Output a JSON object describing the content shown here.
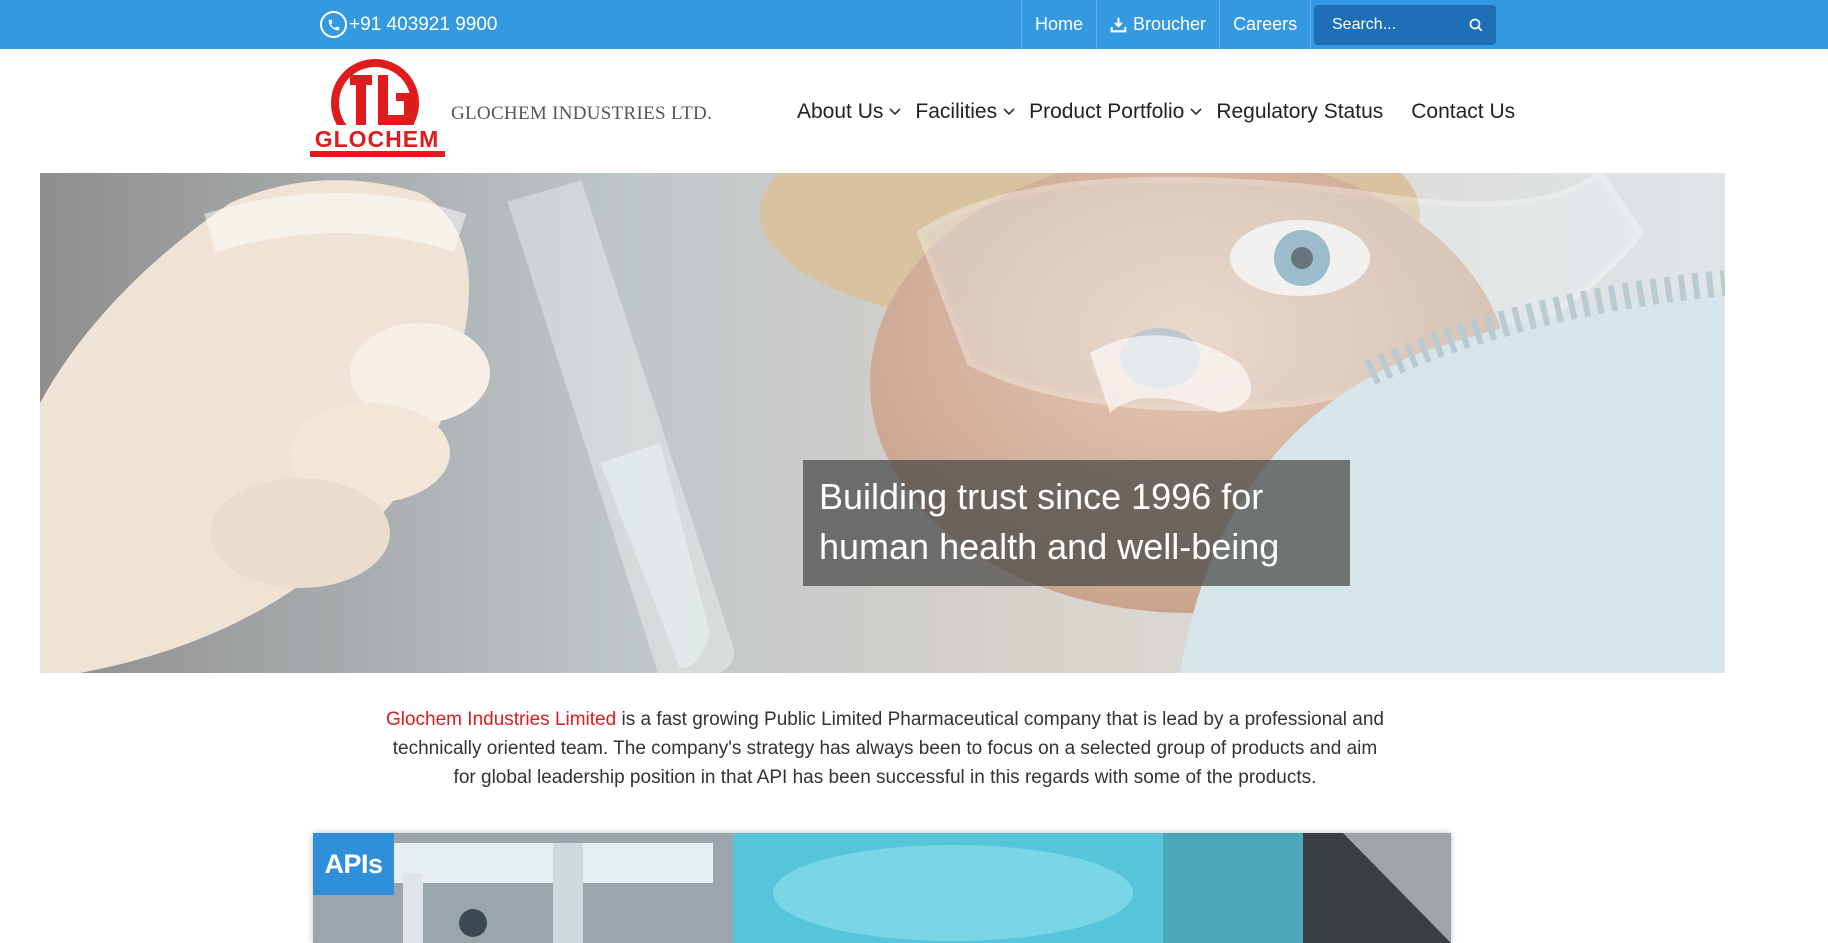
{
  "topbar": {
    "phone": "+91 403921 9900",
    "links": [
      "Home",
      "Broucher",
      "Careers"
    ],
    "search_placeholder": "Search..."
  },
  "header": {
    "logo_text": "GLOCHEM",
    "company_name": "GLOCHEM INDUSTRIES LTD."
  },
  "nav": {
    "about": "About Us",
    "facilities": "Facilities",
    "portfolio": "Product Portfolio",
    "regulatory": "Regulatory Status",
    "contact": "Contact Us"
  },
  "hero": {
    "caption": "Building trust since 1996 for human health and well-being"
  },
  "intro": {
    "brand": "Glochem Industries Limited",
    "text": " is a fast growing Public Limited Pharmaceutical company that is lead by a professional and technically oriented team. The company's strategy has always been to focus on a selected group of products and aim for global leadership position in that API has been successful in this regards with some of the products."
  },
  "card": {
    "tag": "APIs"
  },
  "colors": {
    "topbar": "#3399e0",
    "search_bg": "#1f6fb7",
    "brand_red": "#e01b1b",
    "tag_blue": "#2f8fd8"
  }
}
